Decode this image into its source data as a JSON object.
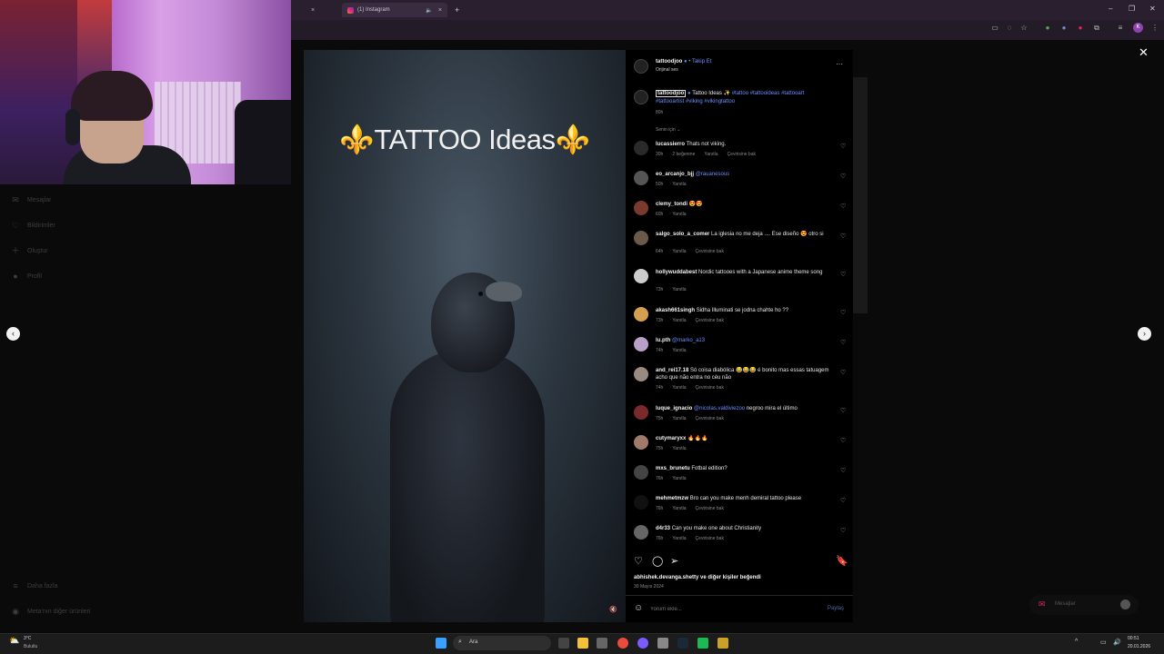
{
  "browser": {
    "tabs": [
      {
        "label": "(1) Instagram",
        "active": true
      }
    ],
    "new_tab_label": "+",
    "close_tab_label": "×",
    "window_controls": [
      "–",
      "❐",
      "✕"
    ],
    "profile_initial": "K"
  },
  "sidebar": {
    "items": [
      {
        "label": "Mesajlar",
        "icon": "messenger-icon"
      },
      {
        "label": "Bildirimler",
        "icon": "heart-icon"
      },
      {
        "label": "Oluştur",
        "icon": "plus-icon"
      },
      {
        "label": "Profil",
        "icon": "profile-icon"
      }
    ],
    "more": "Daha fazla",
    "meta": "Meta'nın diğer ürünleri"
  },
  "video": {
    "title": "⚜️TATTOO Ideas⚜️",
    "mute_icon": "speaker-muted-icon"
  },
  "post": {
    "username": "tattoodjoo",
    "follow": "Takip Et",
    "audio": "Orijinal ses",
    "more": "···",
    "caption_user": "tattoodjoo",
    "caption_text": "Tattoo Ideas ✨",
    "caption_tags_1": "#tattoo #tattooideas #tattooart",
    "caption_tags_2": "#tattooartist #viking #vikingtattoo",
    "caption_time": "80h",
    "sort": "Senin için ⌄",
    "comments": [
      {
        "user": "lucassierro",
        "text": "Thats not viking.",
        "time": "30h",
        "likes": "2 beğenme",
        "reply": "Yanıtla",
        "translate": "Çevirisine bak",
        "mention": "",
        "after": ""
      },
      {
        "user": "eo_arcanjo_bjj",
        "text": "",
        "mention": "@rauanesous",
        "after": "",
        "time": "50h",
        "likes": "",
        "reply": "Yanıtla",
        "translate": ""
      },
      {
        "user": "clemy_tondi",
        "text": "😍😍",
        "mention": "",
        "after": "",
        "time": "60h",
        "likes": "",
        "reply": "Yanıtla",
        "translate": ""
      },
      {
        "user": "salgo_solo_a_comer",
        "text": "La iglesia no me deja .... Ese diseño 😍 otro si",
        "mention": "",
        "after": "",
        "time": "64h",
        "likes": "",
        "reply": "Yanıtla",
        "translate": "Çevirisine bak"
      },
      {
        "user": "hollywuddabest",
        "text": "Nordic tattooes with a Japanese anime theme song",
        "mention": "",
        "after": "",
        "time": "73h",
        "likes": "",
        "reply": "Yanıtla",
        "translate": ""
      },
      {
        "user": "akash661singh",
        "text": "Sidha Illuminati se jodna chahte ho ??",
        "mention": "",
        "after": "",
        "time": "73h",
        "likes": "",
        "reply": "Yanıtla",
        "translate": "Çevirisine bak"
      },
      {
        "user": "lu.pth",
        "text": "",
        "mention": "@marko_a13",
        "after": "",
        "time": "74h",
        "likes": "",
        "reply": "Yanıtla",
        "translate": ""
      },
      {
        "user": "and_rei17.18",
        "text": "Só coisa diabólica 😂😂😂 é bonito mas essas tatuagem acho que não entra no céu não",
        "mention": "",
        "after": "",
        "time": "74h",
        "likes": "",
        "reply": "Yanıtla",
        "translate": "Çevirisine bak"
      },
      {
        "user": "luque_ignacio",
        "text": "",
        "mention": "@nicolas.valdiviezoo",
        "after": "negroo mira el último",
        "time": "75h",
        "likes": "",
        "reply": "Yanıtla",
        "translate": "Çevirisine bak"
      },
      {
        "user": "cutymaryxx",
        "text": "🔥🔥🔥",
        "mention": "",
        "after": "",
        "time": "75h",
        "likes": "",
        "reply": "Yanıtla",
        "translate": ""
      },
      {
        "user": "mxs_brunetu",
        "text": "Fotbal edition?",
        "mention": "",
        "after": "",
        "time": "76h",
        "likes": "",
        "reply": "Yanıtla",
        "translate": ""
      },
      {
        "user": "mehmetmzw",
        "text": "Bro can you make menh demiral tattoo please",
        "mention": "",
        "after": "",
        "time": "76h",
        "likes": "",
        "reply": "Yanıtla",
        "translate": "Çevirisine bak"
      },
      {
        "user": "d4r33",
        "text": "Can you make one about Christianity",
        "mention": "",
        "after": "",
        "time": "76h",
        "likes": "",
        "reply": "Yanıtla",
        "translate": "Çevirisine bak"
      }
    ],
    "liked_by": "abhishek.devanga.shetty ve diğer kişiler beğendi",
    "date": "30 Mayıs 2024",
    "comment_placeholder": "Yorum ekle...",
    "share": "Paylaş"
  },
  "messages_pill": "Mesajlar",
  "taskbar": {
    "weather_temp": "3°C",
    "weather_desc": "Bulutlu",
    "search": "Ara",
    "time": "00:51",
    "date": "20.01.2026"
  },
  "colors": {
    "accent_link": "#6b8dff",
    "panel_bg": "#000000",
    "browser_tabbar": "#2a1f2e"
  }
}
